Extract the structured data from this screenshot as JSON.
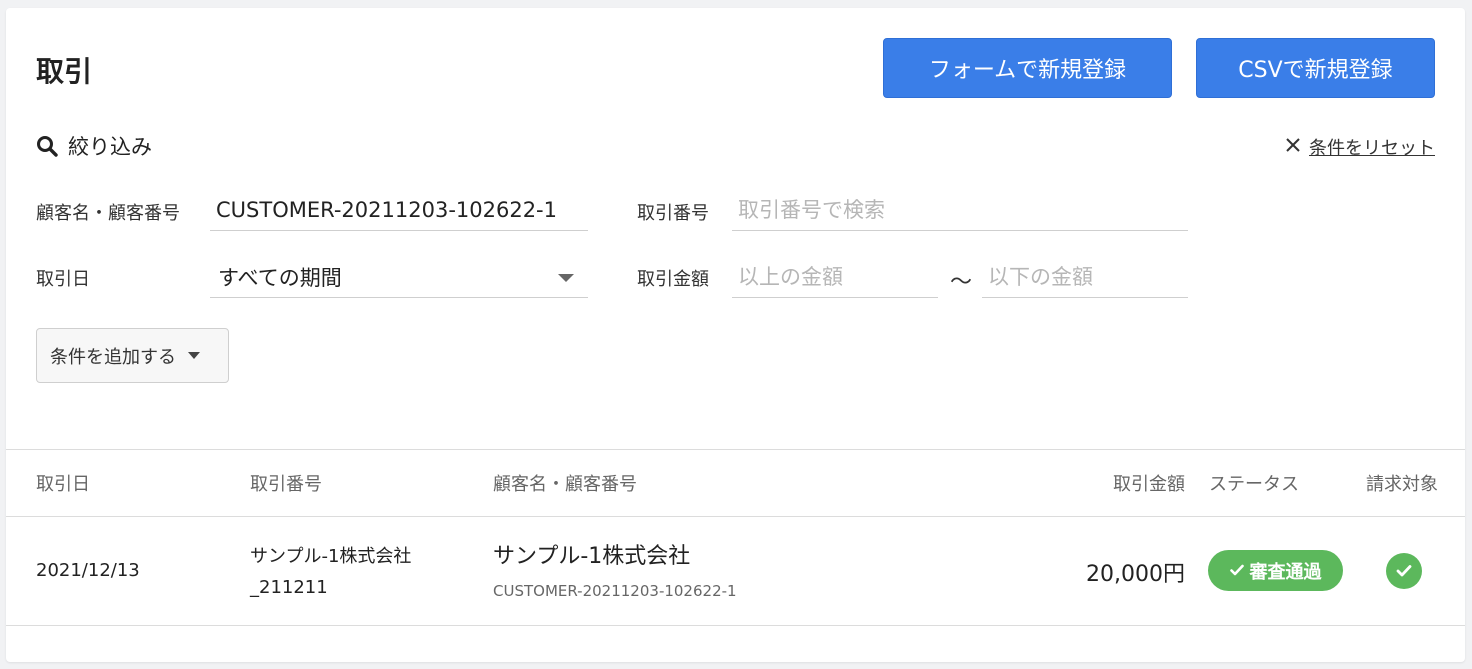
{
  "header": {
    "title": "取引",
    "form_register_label": "フォームで新規登録",
    "csv_register_label": "CSVで新規登録"
  },
  "filter": {
    "heading": "絞り込み",
    "reset_label": "条件をリセット",
    "customer_label": "顧客名・顧客番号",
    "customer_value": "CUSTOMER-20211203-102622-1",
    "txn_number_label": "取引番号",
    "txn_number_placeholder": "取引番号で検索",
    "txn_date_label": "取引日",
    "txn_date_value": "すべての期間",
    "amount_label": "取引金額",
    "amount_min_placeholder": "以上の金額",
    "amount_separator": "〜",
    "amount_max_placeholder": "以下の金額",
    "add_condition_label": "条件を追加する"
  },
  "table": {
    "columns": {
      "date": "取引日",
      "number": "取引番号",
      "customer": "顧客名・顧客番号",
      "amount": "取引金額",
      "status": "ステータス",
      "billing": "請求対象"
    },
    "rows": [
      {
        "date": "2021/12/13",
        "number": "サンプル-1株式会社_211211",
        "customer_name": "サンプル-1株式会社",
        "customer_id": "CUSTOMER-20211203-102622-1",
        "amount": "20,000円",
        "status": "審査通過",
        "billing": true
      }
    ]
  },
  "colors": {
    "primary": "#3a7ee8",
    "success": "#5cb85c",
    "background": "#f1f2f4"
  },
  "icons": [
    "search-icon",
    "close-icon",
    "chevron-down-icon",
    "check-icon"
  ]
}
